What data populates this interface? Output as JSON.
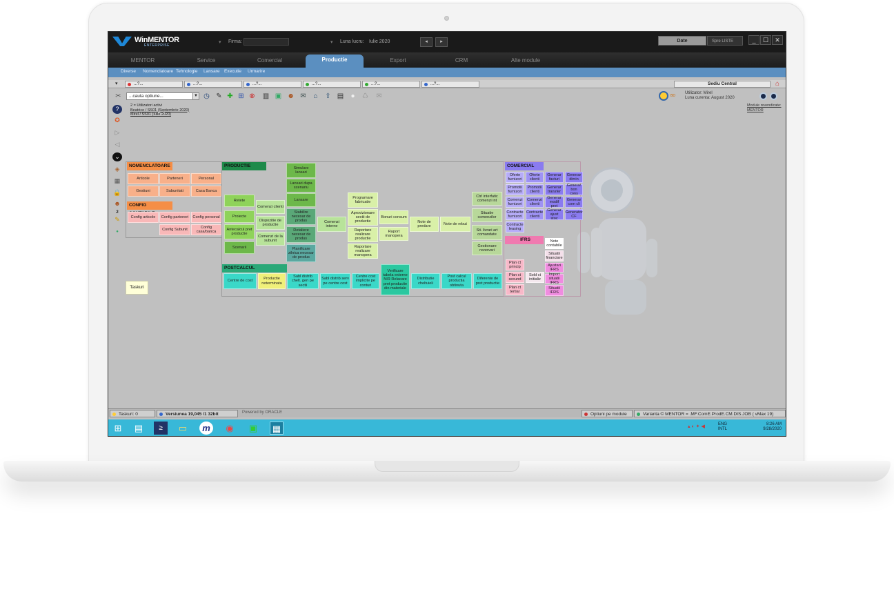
{
  "app": {
    "logo_name": "WinMENTOR",
    "logo_sub": "ENTERPRISE",
    "firma_label": "Firma:",
    "luna_label": "Luna lucru:",
    "luna_value": "Iulie 2020",
    "date_button": "Date",
    "spre_button": "Spre LISTE",
    "prev_label": "◂",
    "next_label": "▸",
    "min_label": "_",
    "max_label": "☐",
    "close_label": "✕"
  },
  "menu": {
    "items": [
      "MENTOR",
      "Service",
      "Comercial",
      "Productie",
      "Export",
      "CRM",
      "Alte module"
    ],
    "active": "Productie"
  },
  "submenu": [
    "Diverse",
    "Nomenclatoare",
    "Tehnologie",
    "Lansare",
    "Executie",
    "Urmarire"
  ],
  "doc_tabs": [
    {
      "label": "...?...",
      "color": "#d33"
    },
    {
      "label": "...?...",
      "color": "#36c"
    },
    {
      "label": "...?...",
      "color": "#36c"
    },
    {
      "label": "...?...",
      "color": "#3a3"
    },
    {
      "label": "...?...",
      "color": "#3a3"
    },
    {
      "label": "...?...",
      "color": "#36c"
    }
  ],
  "sediu": "Sediu Central",
  "toolbar": {
    "search_placeholder": "...cauta optiune...",
    "dropdown_arrow": "▼"
  },
  "active_users": {
    "header": "2 = Utilizatori activi",
    "users": [
      "Beatrice   / SS01 (Septembrie 2020)",
      "Mirel     / SS01 (Iulie 2020)"
    ]
  },
  "user_info": {
    "utilizator": "Utilizator: Mirel",
    "luna_curenta": "Luna curenta: August 2020",
    "bd": "BD"
  },
  "module_revendicate": [
    "Module revendicate:",
    "MENTOR"
  ],
  "taskuri_note": "Taskuri",
  "side_badge": "2",
  "sections": {
    "nomenclatoare": {
      "title": "NOMENCLATOARE",
      "color": "#f58e46",
      "cells": [
        "Articole",
        "Parteneri",
        "Personal",
        "Gestiuni",
        "Subunitati",
        "Casa Banca"
      ]
    },
    "config": {
      "title": "CONFIG CONTABILE",
      "color": "#f58e46",
      "cells": [
        "Config articole",
        "Config parteneri",
        "Config personal",
        "Config Subunit",
        "Config casa/banca"
      ]
    },
    "productie": {
      "title": "PRODUCTIE",
      "color": "#1e8a4a",
      "col1": [
        "Retete",
        "Proiecte",
        "Antecalcul pret productie",
        "Scenarii"
      ],
      "col2": [
        "Comenzi clienti",
        "Dispozitie de productie",
        "Comenzi de la subunit"
      ],
      "col3": [
        "Simulare lansari",
        "Lansari dupa scenariu",
        "Lansare",
        "Stabilire necesar de produs",
        "Detaliere necesar de produs",
        "Planificare zilnica necesar de produs"
      ],
      "comenzi_interne": "Comenzi interne",
      "col5": [
        "Programare fabricatie",
        "Aprovizionare sectii de productie",
        "Raportare realizare productie",
        "Raportare realizare manopera"
      ],
      "col6": [
        "Bonuri consum",
        "Raport manopera"
      ],
      "note_predare": "Note de predare",
      "note_rebut": "Note de rebut",
      "col9": [
        "Ctrl interfatic comenzi int",
        "Situatie comenzilor",
        "Sit. livrari art comandate",
        "Gestionare rezervari"
      ]
    },
    "postcalcul": {
      "title": "POSTCALCUL",
      "color": "#3ac9b8",
      "cells": [
        "Centre de cost",
        "Productie neterminata",
        "Sabl distrib chelt. gen pe sectii",
        "Sabl distrib serv pe centre cost",
        "Centre cost implicite pe conturi",
        "Verificare tabela externe NIR Relacare pret productie din materiale",
        "Distributie cheltuieli",
        "Post calcul productia obtinuta",
        "Diferente de pret productie"
      ]
    },
    "comercial": {
      "title": "COMERCIAL",
      "color": "#8a7bf0",
      "col1": [
        "Oferte furnizori",
        "Promotii furnizori",
        "Comenzi furnizori",
        "Contracte furnizori",
        "Contracte leasing"
      ],
      "col2": [
        "Oferte clienti",
        "Promotii clienti",
        "Comenzi clienti",
        "Contracte clienti"
      ],
      "col3": [
        "Generar facturi",
        "Generar transfer",
        "Generar modif pret",
        "Generar ajust stoc"
      ],
      "col4": [
        "Generar dimin",
        "Generar bon cons",
        "Generar com cli",
        "Generator CF"
      ]
    },
    "ifrs": {
      "title": "IFRS",
      "color": "#f07ab0",
      "col1": [
        "Plan ct princip",
        "Plan ct secund",
        "Plan ct tertiar"
      ],
      "sold": "Sold ct initializ",
      "col3": [
        "Note contabile",
        "Situatii financiare",
        "Ajustari IFRS",
        "Import situatii IFRS",
        "Situatii IFRS"
      ]
    }
  },
  "statusbar": {
    "taskuri": "Taskuri: 0",
    "versiune": "Versiunea 19,045 /1 32bit",
    "powered": "Powered by ORACLE",
    "optiuni": "Optiuni pe module",
    "varianta": "Varianta © MENTOR = .MF.ComE.ProdE.CM.DIS.JOB ( vMax 19)"
  },
  "tray": {
    "lang": "ENG",
    "layout": "INTL",
    "time": "8:26 AM",
    "date": "9/28/2020"
  }
}
